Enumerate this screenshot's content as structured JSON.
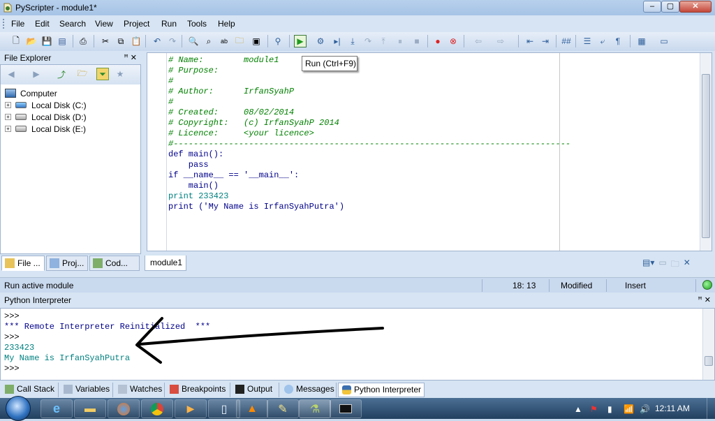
{
  "window": {
    "title": "PyScripter - module1*"
  },
  "menu": [
    "File",
    "Edit",
    "Search",
    "View",
    "Project",
    "Run",
    "Tools",
    "Help"
  ],
  "tooltip": "Run (Ctrl+F9)",
  "file_explorer": {
    "title": "File Explorer",
    "root": "Computer",
    "drives": [
      "Local Disk (C:)",
      "Local Disk (D:)",
      "Local Disk (E:)"
    ],
    "tabs": [
      "File ...",
      "Proj...",
      "Cod..."
    ]
  },
  "editor": {
    "tab": "module1",
    "lines": [
      "# Name:        module1",
      "# Purpose:",
      "#",
      "# Author:      IrfanSyahP",
      "#",
      "# Created:     08/02/2014",
      "# Copyright:   (c) IrfanSyahP 2014",
      "# Licence:     <your licence>",
      "#-------------------------------------------------------------------------------",
      "",
      "def main():",
      "    pass",
      "",
      "if __name__ == '__main__':",
      "    main()",
      "",
      "print 233423",
      "print ('My Name is IrfanSyahPutra')"
    ]
  },
  "status": {
    "message": "Run active module",
    "position": "18: 13",
    "modified": "Modified",
    "mode": "Insert"
  },
  "interpreter": {
    "title": "Python Interpreter",
    "lines": [
      ">>>",
      "*** Remote Interpreter Reinitialized  ***",
      ">>>",
      "233423",
      "My Name is IrfanSyahPutra",
      ">>>"
    ]
  },
  "bottom_tabs": [
    "Call Stack",
    "Variables",
    "Watches",
    "Breakpoints",
    "Output",
    "Messages",
    "Python Interpreter"
  ],
  "taskbar": {
    "clock": "12:11 AM"
  },
  "colors": {
    "comment": "#008000",
    "keyword": "#00008b",
    "number": "#008080",
    "string": "#800080",
    "run_green": "#1f9b1f"
  }
}
